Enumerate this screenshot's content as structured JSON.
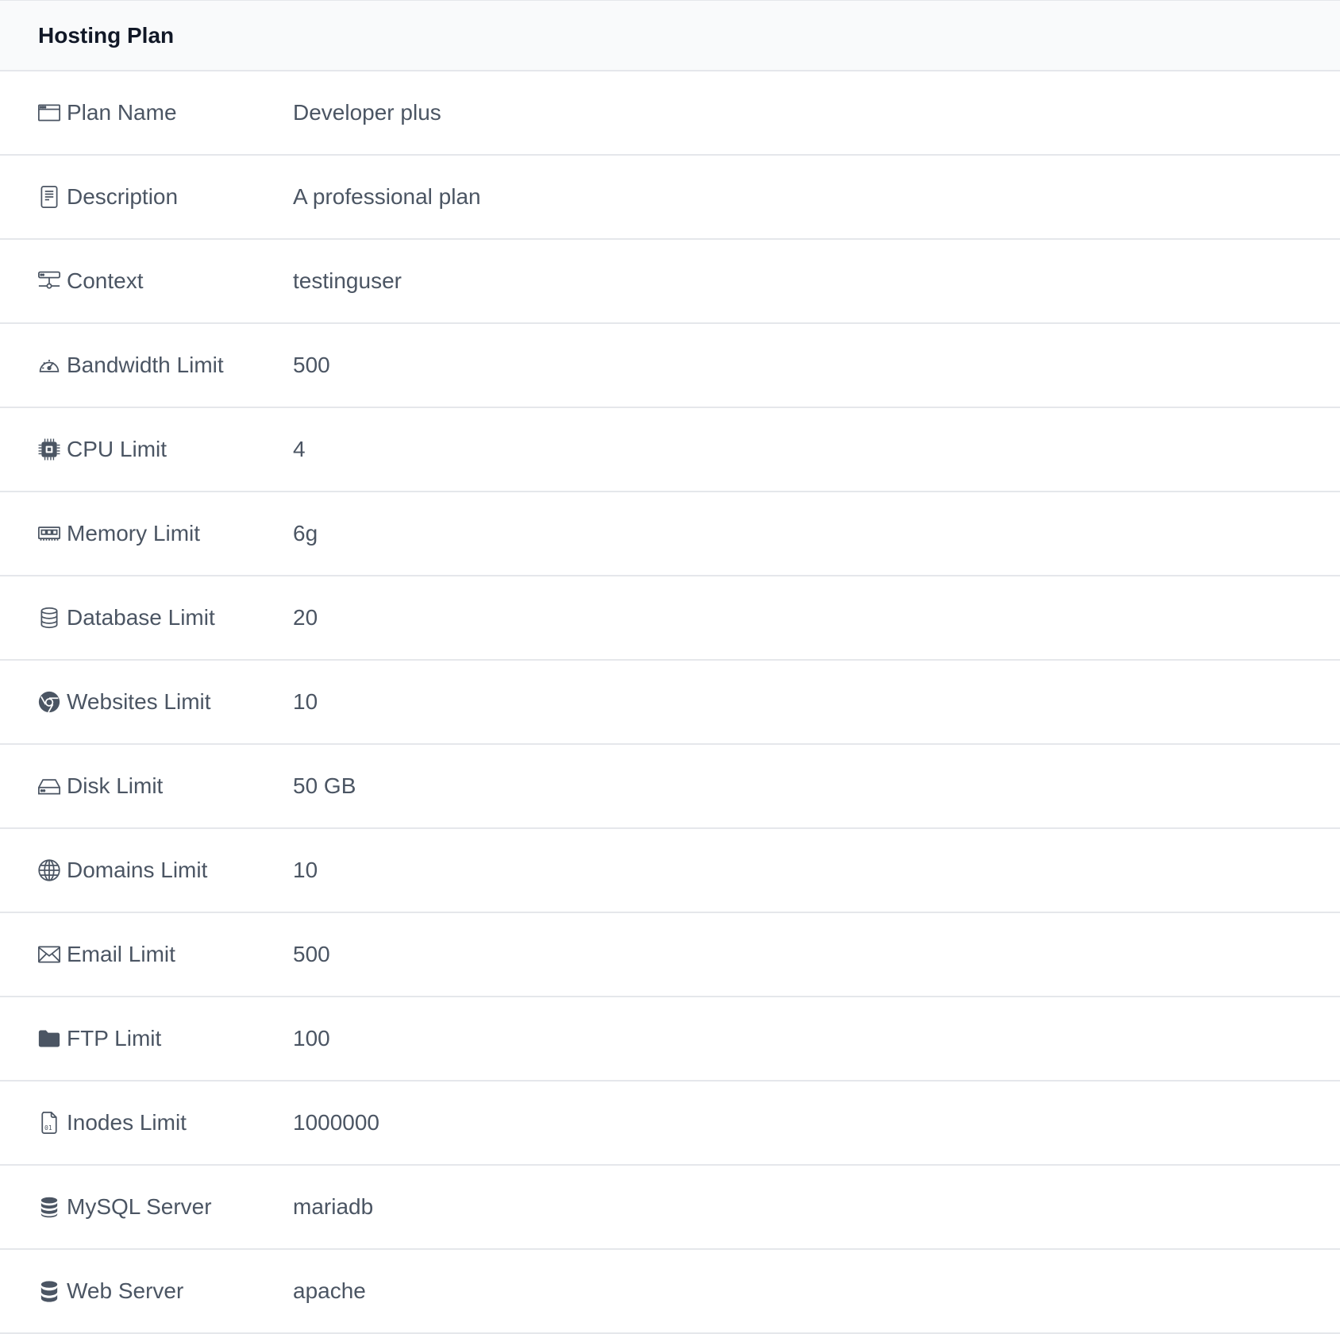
{
  "header": {
    "title": "Hosting Plan"
  },
  "rows": [
    {
      "icon": "window-icon",
      "label": "Plan Name",
      "value": "Developer plus"
    },
    {
      "icon": "document-icon",
      "label": "Description",
      "value": "A professional plan"
    },
    {
      "icon": "network-icon",
      "label": "Context",
      "value": "testinguser"
    },
    {
      "icon": "speedometer-icon",
      "label": "Bandwidth Limit",
      "value": "500"
    },
    {
      "icon": "cpu-icon",
      "label": "CPU Limit",
      "value": "4"
    },
    {
      "icon": "memory-icon",
      "label": "Memory Limit",
      "value": "6g"
    },
    {
      "icon": "database-icon",
      "label": "Database Limit",
      "value": "20"
    },
    {
      "icon": "chrome-icon",
      "label": "Websites Limit",
      "value": "10"
    },
    {
      "icon": "hard-drive-icon",
      "label": "Disk Limit",
      "value": "50 GB"
    },
    {
      "icon": "globe-icon",
      "label": "Domains Limit",
      "value": "10"
    },
    {
      "icon": "envelope-icon",
      "label": "Email Limit",
      "value": "500"
    },
    {
      "icon": "folder-icon",
      "label": "FTP Limit",
      "value": "100"
    },
    {
      "icon": "binary-file-icon",
      "label": "Inodes Limit",
      "value": "1000000"
    },
    {
      "icon": "database-fill-icon",
      "label": "MySQL Server",
      "value": "mariadb"
    },
    {
      "icon": "database-solid-icon",
      "label": "Web Server",
      "value": "apache"
    }
  ]
}
